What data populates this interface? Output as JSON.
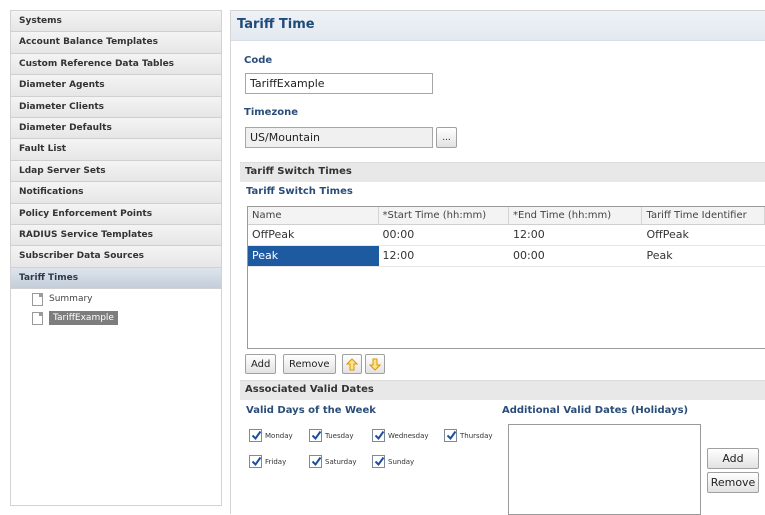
{
  "sidebar": {
    "items": [
      {
        "label": "Systems"
      },
      {
        "label": "Account Balance Templates"
      },
      {
        "label": "Custom Reference Data Tables"
      },
      {
        "label": "Diameter Agents"
      },
      {
        "label": "Diameter Clients"
      },
      {
        "label": "Diameter Defaults"
      },
      {
        "label": "Fault List"
      },
      {
        "label": "Ldap Server Sets"
      },
      {
        "label": "Notifications"
      },
      {
        "label": "Policy Enforcement Points"
      },
      {
        "label": "RADIUS Service Templates"
      },
      {
        "label": "Subscriber Data Sources"
      },
      {
        "label": "Tariff Times"
      }
    ],
    "tree": [
      {
        "label": "Summary"
      },
      {
        "label": "TariffExample"
      }
    ]
  },
  "main": {
    "title": "Tariff Time",
    "code_label": "Code",
    "code_value": "TariffExample",
    "timezone_label": "Timezone",
    "timezone_value": "US/Mountain",
    "browse_label": "...",
    "switch_section_title": "Tariff Switch Times",
    "switch_subtitle": "Tariff Switch Times",
    "table": {
      "columns": [
        "Name",
        "*Start Time (hh:mm)",
        "*End Time (hh:mm)",
        "Tariff Time Identifier"
      ],
      "rows": [
        [
          "OffPeak",
          "00:00",
          "12:00",
          "OffPeak"
        ],
        [
          "Peak",
          "12:00",
          "00:00",
          "Peak"
        ]
      ]
    },
    "add_label": "Add",
    "remove_label": "Remove",
    "dates_section_title": "Associated Valid Dates",
    "valid_days_label": "Valid Days of the Week",
    "days": [
      {
        "label": "Monday",
        "checked": true
      },
      {
        "label": "Tuesday",
        "checked": true
      },
      {
        "label": "Wednesday",
        "checked": true
      },
      {
        "label": "Thursday",
        "checked": true
      },
      {
        "label": "Friday",
        "checked": true
      },
      {
        "label": "Saturday",
        "checked": true
      },
      {
        "label": "Sunday",
        "checked": true
      }
    ],
    "holidays_label": "Additional Valid Dates (Holidays)",
    "holiday_add_label": "Add",
    "holiday_remove_label": "Remove"
  },
  "colors": {
    "accent": "#1e5aa0",
    "title": "#1f4b7a",
    "arrow": "#e2a000"
  },
  "icons": [
    "document-icon",
    "arrow-up-icon",
    "arrow-down-icon",
    "checkmark-icon"
  ]
}
